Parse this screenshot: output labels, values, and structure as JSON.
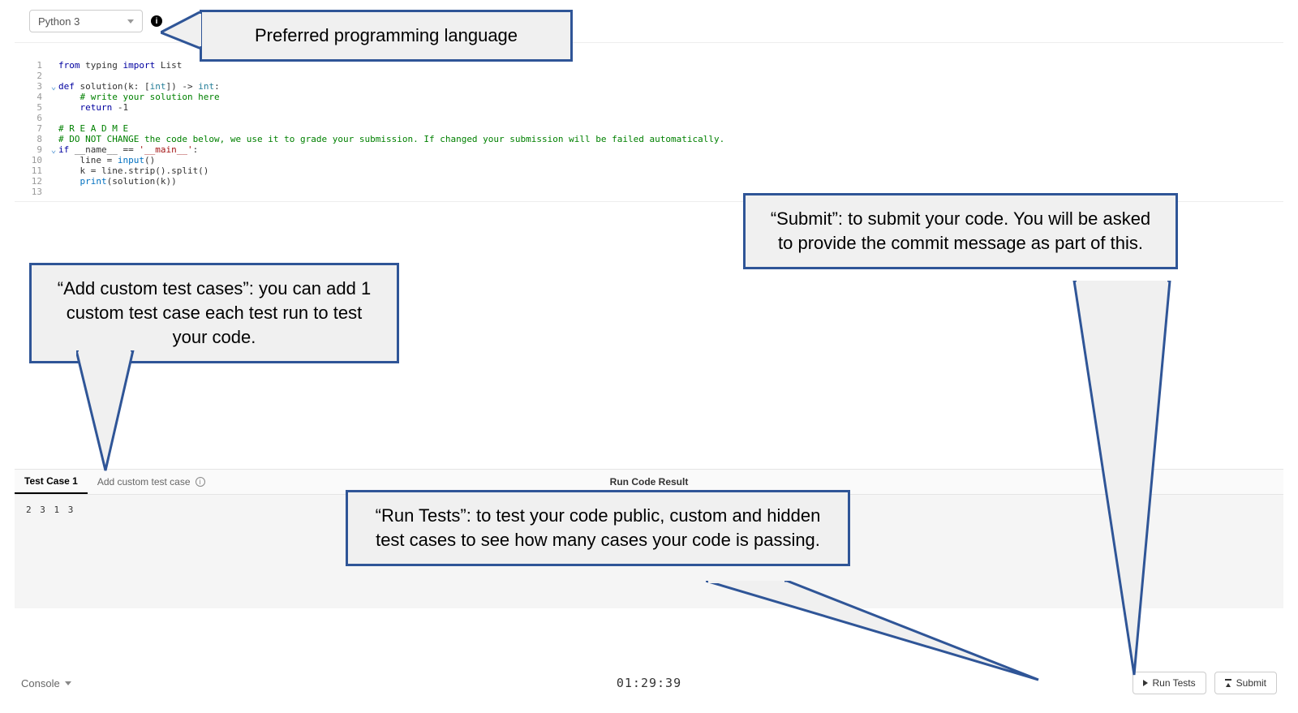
{
  "toolbar": {
    "language": "Python 3"
  },
  "code": {
    "line1": "from typing import List",
    "line3_a": "def",
    "line3_b": " solution(k: [",
    "line3_c": "int",
    "line3_d": "]) -> ",
    "line3_e": "int",
    "line3_f": ":",
    "line4": "    # write your solution here",
    "line5_a": "    return",
    "line5_b": " -1",
    "line7": "# R E A D M E",
    "line8": "# DO NOT CHANGE the code below, we use it to grade your submission. If changed your submission will be failed automatically.",
    "line9_a": "if",
    "line9_b": " __name__ == ",
    "line9_c": "'__main__'",
    "line9_d": ":",
    "line10_a": "    line = ",
    "line10_b": "input",
    "line10_c": "()",
    "line11": "    k = line.strip().split()",
    "line12_a": "    print",
    "line12_b": "(solution(k))"
  },
  "testTabs": {
    "tab1": "Test Case 1",
    "add": "Add custom test case",
    "result": "Run Code Result"
  },
  "testInput": "2 3 1 3",
  "footer": {
    "console": "Console",
    "timer": "01:29:39",
    "runTests": "Run Tests",
    "submit": "Submit"
  },
  "callouts": {
    "language": "Preferred programming language",
    "addTest": "“Add custom test cases”: you can add 1 custom test case each test run to test your code.",
    "submit": "“Submit”: to submit your code. You will be asked to provide the commit message as part of this.",
    "runTests": "“Run Tests”: to test your code public, custom and hidden test cases to see how many cases your code is passing."
  },
  "lineNumbers": [
    "1",
    "2",
    "3",
    "4",
    "5",
    "6",
    "7",
    "8",
    "9",
    "10",
    "11",
    "12",
    "13"
  ]
}
